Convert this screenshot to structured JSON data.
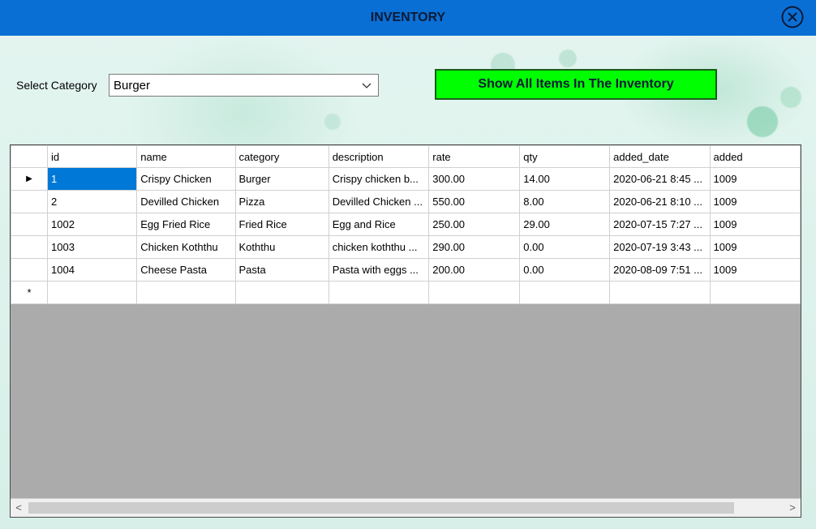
{
  "window": {
    "title": "INVENTORY",
    "close_icon": "circle-x-icon"
  },
  "filter": {
    "label": "Select Category",
    "selected": "Burger",
    "show_all_label": "Show All Items In The Inventory"
  },
  "colors": {
    "titlebar": "#0a6fd4",
    "button_bg": "#00ff00",
    "selection": "#0078d7"
  },
  "grid": {
    "columns": [
      "id",
      "name",
      "category",
      "description",
      "rate",
      "qty",
      "added_date",
      "added"
    ],
    "rows": [
      [
        "1",
        "Crispy Chicken",
        "Burger",
        "Crispy chicken b...",
        "300.00",
        "14.00",
        "2020-06-21 8:45 ...",
        "1009"
      ],
      [
        "2",
        "Devilled Chicken",
        "Pizza",
        "Devilled Chicken ...",
        "550.00",
        "8.00",
        "2020-06-21 8:10 ...",
        "1009"
      ],
      [
        "1002",
        "Egg Fried Rice",
        "Fried Rice",
        "Egg and Rice",
        "250.00",
        "29.00",
        "2020-07-15 7:27 ...",
        "1009"
      ],
      [
        "1003",
        "Chicken Koththu",
        "Koththu",
        "chicken koththu ...",
        "290.00",
        "0.00",
        "2020-07-19 3:43 ...",
        "1009"
      ],
      [
        "1004",
        "Cheese Pasta",
        "Pasta",
        "Pasta with eggs ...",
        "200.00",
        "0.00",
        "2020-08-09 7:51 ...",
        "1009"
      ]
    ],
    "current_row_marker": "▶",
    "new_row_marker": "*",
    "scroll_left": "<",
    "scroll_right": ">"
  }
}
